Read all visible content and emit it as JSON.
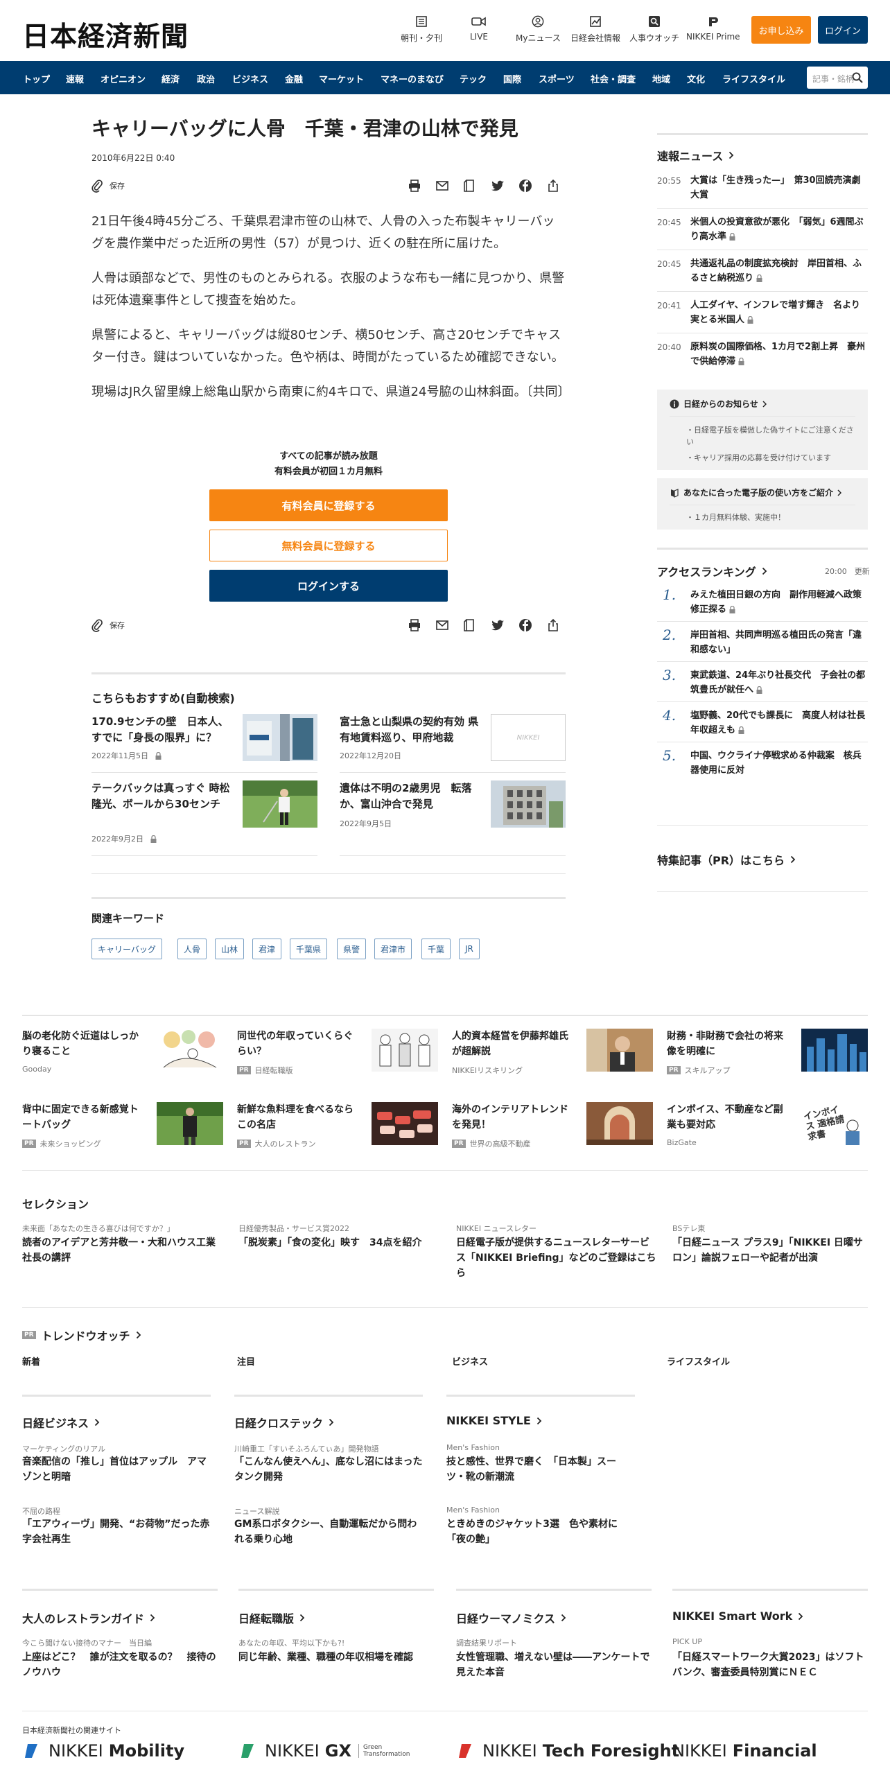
{
  "header": {
    "logo": "日本経済新聞",
    "nav": [
      {
        "label": "朝刊・夕刊",
        "icon": "newspaper-icon"
      },
      {
        "label": "LIVE",
        "icon": "video-camera-icon"
      },
      {
        "label": "Myニュース",
        "icon": "user-icon"
      },
      {
        "label": "日経会社情報",
        "icon": "chart-icon"
      },
      {
        "label": "人事ウオッチ",
        "icon": "search-person-icon"
      },
      {
        "label": "NIKKEI Prime",
        "icon": "prime-icon"
      }
    ],
    "apply_label": "お申し込み",
    "login_label": "ログイン"
  },
  "gnav": {
    "items": [
      "トップ",
      "速報",
      "オピニオン",
      "経済",
      "政治",
      "ビジネス",
      "金融",
      "マーケット",
      "マネーのまなび",
      "テック",
      "国際",
      "スポーツ",
      "社会・調査",
      "地域",
      "文化",
      "ライフスタイル"
    ],
    "search_placeholder": "記事・銘柄"
  },
  "article": {
    "title": "キャリーバッグに人骨　千葉・君津の山林で発見",
    "date": "2010年6月22日 0:40",
    "save_label": "保存",
    "paragraphs": [
      "21日午後4時45分ごろ、千葉県君津市笹の山林で、人骨の入った布製キャリーバッグを農作業中だった近所の男性（57）が見つけ、近くの駐在所に届けた。",
      "人骨は頭部などで、男性のものとみられる。衣服のような布も一緒に見つかり、県警は死体遺棄事件として捜査を始めた。",
      "県警によると、キャリーバッグは縦80センチ、横50センチ、高さ20センチでキャスター付き。鍵はついていなかった。色や柄は、時間がたっているため確認できない。",
      "現場はJR久留里線上総亀山駅から南東に約4キロで、県道24号脇の山林斜面。〔共同〕"
    ]
  },
  "paywall": {
    "line1": "すべての記事が読み放題",
    "line2": "有料会員が初回１カ月無料",
    "paid_label": "有料会員に登録する",
    "free_label": "無料会員に登録する",
    "login_label": "ログインする"
  },
  "recommend": {
    "title": "こちらもおすすめ(自動検索)",
    "items": [
      {
        "title": "170.9センチの壁　日本人、すでに「身長の限界」に？",
        "date": "2022年11月5日",
        "locked": true
      },
      {
        "title": "富士急と山梨県の契約有効 県有地賃料巡り、甲府地裁",
        "date": "2022年12月20日",
        "locked": false,
        "thumb_text": "NIKKEI"
      },
      {
        "title": "テークバックは真っすぐ 時松隆光、ボールから30センチ",
        "date": "2022年9月2日",
        "locked": true
      },
      {
        "title": "遺体は不明の2歳男児　転落か、富山沖合で発見",
        "date": "2022年9月5日",
        "locked": false
      }
    ]
  },
  "keywords": {
    "title": "関連キーワード",
    "items": [
      "キャリーバッグ",
      "人骨",
      "山林",
      "君津",
      "千葉県",
      "県警",
      "君津市",
      "千葉",
      "JR"
    ]
  },
  "sidebar": {
    "breaking_title": "速報ニュース",
    "breaking": [
      {
        "time": "20:55",
        "title": "大賞は「生き残った—」　第30回読売演劇大賞",
        "locked": false
      },
      {
        "time": "20:45",
        "title": "米個人の投資意欲が悪化　「弱気」6週間ぶり高水準",
        "locked": true
      },
      {
        "time": "20:45",
        "title": "共通返礼品の制度拡充検討　岸田首相、ふるさと納税巡り",
        "locked": true
      },
      {
        "time": "20:41",
        "title": "人工ダイヤ、インフレで増す輝き　名より実とる米国人",
        "locked": true
      },
      {
        "time": "20:40",
        "title": "原料炭の国際価格、1カ月で2割上昇　豪州で供給停滞",
        "locked": true
      }
    ],
    "info_title": "日経からのお知らせ",
    "info_items": [
      "日経電子版を模倣した偽サイトにご注意ください",
      "キャリア採用の応募を受け付けています"
    ],
    "guide_title": "あなたに合った電子版の使い方をご紹介",
    "guide_items": [
      "１カ月無料体験、実施中！"
    ],
    "ranking_title": "アクセスランキング",
    "ranking_time": "20:00",
    "ranking_update": "更新",
    "ranking": [
      {
        "rank": "1.",
        "title": "みえた植田日銀の方向　副作用軽減へ政策修正探る",
        "locked": true
      },
      {
        "rank": "2.",
        "title": "岸田首相、共同声明巡る植田氏の発言「違和感ない」",
        "locked": false
      },
      {
        "rank": "3.",
        "title": "東武鉄道、24年ぶり社長交代　子会社の都筑豊氏が就任へ",
        "locked": true
      },
      {
        "rank": "4.",
        "title": "塩野義、20代でも課長に　高度人材は社長年収超えも",
        "locked": true
      },
      {
        "rank": "5.",
        "title": "中国、ウクライナ停戦求める仲裁案　核兵器使用に反対",
        "locked": false
      }
    ],
    "special_title": "特集記事（PR）はこちら"
  },
  "ads": [
    {
      "title": "脳の老化防ぐ近道はしっかり寝ること",
      "source": "Gooday",
      "pr": false
    },
    {
      "title": "同世代の年収っていくらぐらい？",
      "source": "日経転職版",
      "pr": true
    },
    {
      "title": "人的資本経営を伊藤邦雄氏が超解説",
      "source": "NIKKEIリスキリング",
      "pr": false
    },
    {
      "title": "財務・非財務で会社の将来像を明確に",
      "source": "スキルアップ",
      "pr": true
    },
    {
      "title": "背中に固定できる新感覚トートバッグ",
      "source": "未来ショッピング",
      "pr": true
    },
    {
      "title": "新鮮な魚料理を食べるならこの名店",
      "source": "大人のレストラン",
      "pr": true
    },
    {
      "title": "海外のインテリアトレンドを発見！",
      "source": "世界の高級不動産",
      "pr": true
    },
    {
      "title": "インボイス、不動産など副業も要対応",
      "source": "BizGate",
      "pr": false,
      "thumb_text": "インボイス 適格請求書"
    }
  ],
  "selection": {
    "title": "セレクション",
    "items": [
      {
        "sub": "未来面「あなたの生きる喜びは何ですか？」",
        "title": "読者のアイデアと芳井敬一・大和ハウス工業社長の講評"
      },
      {
        "sub": "日経優秀製品・サービス賞2022",
        "title": "「脱炭素」「食の変化」映す　34点を紹介"
      },
      {
        "sub": "NIKKEI ニュースレター",
        "title": "日経電子版が提供するニュースレターサービス「NIKKEI Briefing」などのご登録はこちら"
      },
      {
        "sub": "BSテレ東",
        "title": "「日経ニュース プラス9」「NIKKEI 日曜サロン」論説フェローや記者が出演"
      }
    ]
  },
  "trend": {
    "pr": "PR",
    "title": "トレンドウオッチ",
    "columns": [
      "新着",
      "注目",
      "ビジネス",
      "ライフスタイル"
    ]
  },
  "blocks1": [
    {
      "title": "日経ビジネス",
      "items": [
        {
          "sub": "マーケティングのリアル",
          "title": "音楽配信の「推し」首位はアップル　アマゾンと明暗"
        },
        {
          "sub": "不屈の路程",
          "title": "「エアウィーヴ」開発、“お荷物”だった赤字会社再生"
        }
      ]
    },
    {
      "title": "日経クロステック",
      "items": [
        {
          "sub": "川崎重工「すいそふろんてぃあ」開発物語",
          "title": "「こんなん使えへん」、底なし沼にはまったタンク開発"
        },
        {
          "sub": "ニュース解説",
          "title": "GM系ロボタクシー、自動運転だから問われる乗り心地"
        }
      ]
    },
    {
      "title": "NIKKEI STYLE",
      "items": [
        {
          "sub": "Men's Fashion",
          "title": "技と感性、世界で磨く　「日本製」スーツ・靴の新潮流"
        },
        {
          "sub": "Men's Fashion",
          "title": "ときめきのジャケット3選　色や素材に「夜の艶」"
        }
      ]
    }
  ],
  "blocks2": [
    {
      "title": "大人のレストランガイド",
      "sub": "今こら聞けない接待のマナー　当日編",
      "item": "上座はどこ？　誰が注文を取るの？　接待のノウハウ"
    },
    {
      "title": "日経転職版",
      "sub": "あなたの年収、平均以下かも?!",
      "item": "同じ年齢、業種、職種の年収相場を確認"
    },
    {
      "title": "日経ウーマノミクス",
      "sub": "調査結果リポート",
      "item": "女性管理職、増えない壁は――アンケートで見えた本音"
    },
    {
      "title": "NIKKEI Smart Work",
      "sub": "PICK UP",
      "item": "「日経スマートワーク大賞2023」はソフトバンク、審査委員特別賞にＮＥＣ"
    }
  ],
  "related": {
    "title": "日本経済新聞社の関連サイト",
    "brands": [
      {
        "prefix": "NIKKEI",
        "name": "Mobility",
        "color": "#1f6fc4"
      },
      {
        "prefix": "NIKKEI",
        "name": "GX",
        "sub": "Green Transformation",
        "color": "#2aa06a"
      },
      {
        "prefix": "NIKKEI",
        "name": "Tech Foresight",
        "color": "#d9322b"
      },
      {
        "prefix": "NIKKEI",
        "name": "Financial",
        "color": "#222222"
      }
    ]
  }
}
